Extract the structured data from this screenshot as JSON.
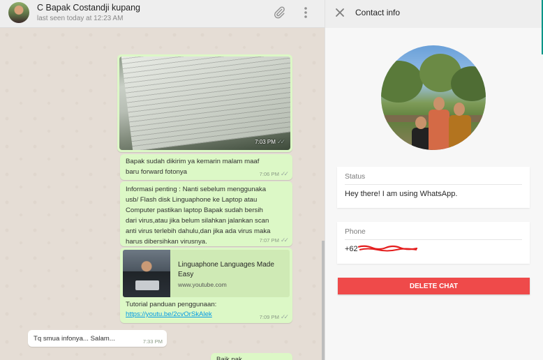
{
  "chat": {
    "contact_name": "C Bapak Costandji kupang",
    "last_seen": "last seen today at 12:23 AM",
    "attach_icon": "paperclip-icon",
    "menu_icon": "kebab-menu-icon",
    "messages": [
      {
        "type": "image",
        "direction": "out",
        "time": "7:03 PM",
        "status": "read"
      },
      {
        "type": "text",
        "direction": "out",
        "text": "Bapak sudah dikirim ya kemarin malam maaf\nbaru forward fotonya",
        "time": "7:06 PM",
        "status": "read"
      },
      {
        "type": "text",
        "direction": "out",
        "text": "Informasi penting : Nanti sebelum menggunaka\nusb/ Flash disk Linguaphone ke Laptop atau\nComputer pastikan laptop Bapak sudah bersih\ndari virus,atau jika belum silahkan jalankan scan\nanti virus terlebih dahulu,dan jika ada virus maka\nharus dibersihkan virusnya.",
        "time": "7:07 PM",
        "status": "read"
      },
      {
        "type": "link",
        "direction": "out",
        "preview_title": "Linguaphone Languages Made Easy",
        "preview_domain": "www.youtube.com",
        "text": "Tutorial panduan penggunaan:",
        "url": "https://youtu.be/2cvOrSkAlek",
        "time": "7:09 PM",
        "status": "read"
      },
      {
        "type": "text",
        "direction": "in",
        "text": "Tq smua infonya... Salam...",
        "time": "7:33 PM"
      },
      {
        "type": "text",
        "direction": "out",
        "text": "Baik pak"
      }
    ]
  },
  "contact_info": {
    "title": "Contact info",
    "close_icon": "close-icon",
    "status_label": "Status",
    "status_text": "Hey there! I am using WhatsApp.",
    "phone_label": "Phone",
    "phone_prefix": "+62",
    "delete_label": "DELETE CHAT"
  },
  "colors": {
    "outgoing_bubble": "#dcf8c6",
    "incoming_bubble": "#ffffff",
    "accent": "#009688",
    "delete_button": "#ef4a4a",
    "link": "#039be5"
  }
}
